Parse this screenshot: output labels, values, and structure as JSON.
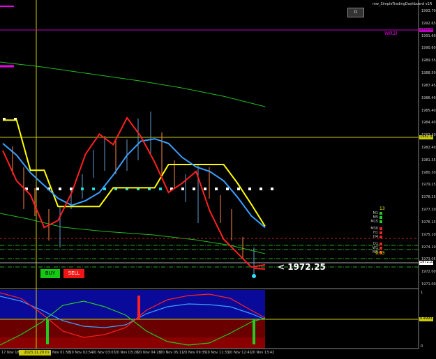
{
  "title": "mw_SimpleTradingDashboard v1R",
  "dashboard_button_label": "D",
  "level_label": "WR3l",
  "buttons": {
    "buy": "BUY",
    "sell": "SELL"
  },
  "big_price": "<  1972.25",
  "timeframe_count": "13",
  "timeframe_time": "9:53",
  "timeframes": [
    {
      "label": "M1",
      "color": "#22cc22"
    },
    {
      "label": "M5",
      "color": "#22cc22"
    },
    {
      "label": "M15",
      "color": "#22cc22"
    },
    {
      "label": "M30",
      "color": "#ee2222"
    },
    {
      "label": "H1",
      "color": "#ee2222"
    },
    {
      "label": "H4",
      "color": "#ee2222"
    },
    {
      "label": "D1",
      "color": "#ee2222"
    },
    {
      "label": "W1",
      "color": "#ee2222"
    },
    {
      "label": "MN",
      "color": "#ee2222"
    }
  ],
  "price_axis": [
    "1993.70",
    "1992.65",
    "1991.60",
    "1990.60",
    "1989.55",
    "1988.50",
    "1987.45",
    "1986.40",
    "1985.40",
    "1984.40",
    "1983.40",
    "1982.40",
    "1981.35",
    "1980.30",
    "1979.25",
    "1978.25",
    "1977.20",
    "1976.15",
    "1975.10",
    "1974.10",
    "1973.05",
    "1972.00",
    "1971.00"
  ],
  "price_tags": {
    "wr3": "1991.60",
    "yellow": "1982.97",
    "current": "1972.25"
  },
  "indicator_axis": {
    "top": "1",
    "mid": "0.4993",
    "bottom": "0"
  },
  "time_axis": [
    "17 Nov 18:2",
    "2023.11.20 01:04",
    "20 Nov 01:58",
    "20 Nov 02:54",
    "20 Nov 03:07",
    "20 Nov 03:28",
    "20 Nov 04:28",
    "20 Nov 05:11",
    "20 Nov 09:35",
    "20 Nov 11:33",
    "20 Nov 12:41",
    "20 Nov 13:42"
  ],
  "colors": {
    "buy": "#14c814",
    "sell": "#f01414",
    "yellow": "#ffff00",
    "blue": "#3aa0ff",
    "red": "#ff2020",
    "green": "#22cc22",
    "magenta": "#cc00cc",
    "orange": "#ff8844"
  },
  "chart_data": {
    "type": "line",
    "ylim": [
      1970.0,
      1994.2
    ],
    "series": [
      {
        "values": [
          1984.2,
          1984.2,
          1979.9,
          1979.9,
          1976.8,
          1976.8,
          1976.8,
          1976.8,
          1978.4,
          1978.4,
          1978.4,
          1978.4,
          1980.4,
          1980.4,
          1980.4,
          1980.4,
          1980.4,
          1978.8,
          1977.0,
          1975.1
        ]
      },
      {
        "values": [
          1982.2,
          1981.2,
          1979.7,
          1978.6,
          1977.5,
          1976.9,
          1977.3,
          1978.0,
          1979.5,
          1981.2,
          1982.4,
          1982.6,
          1982.2,
          1981.0,
          1980.2,
          1979.8,
          1979.0,
          1977.6,
          1976.0,
          1975.0
        ]
      },
      {
        "values": [
          1981.6,
          1979.0,
          1977.8,
          1975.0,
          1975.6,
          1978.0,
          1981.3,
          1983.0,
          1982.1,
          1984.4,
          1982.8,
          1980.6,
          1978.0,
          1978.8,
          1979.8,
          1976.4,
          1974.0,
          1972.8,
          1971.6,
          1971.8
        ]
      }
    ]
  }
}
